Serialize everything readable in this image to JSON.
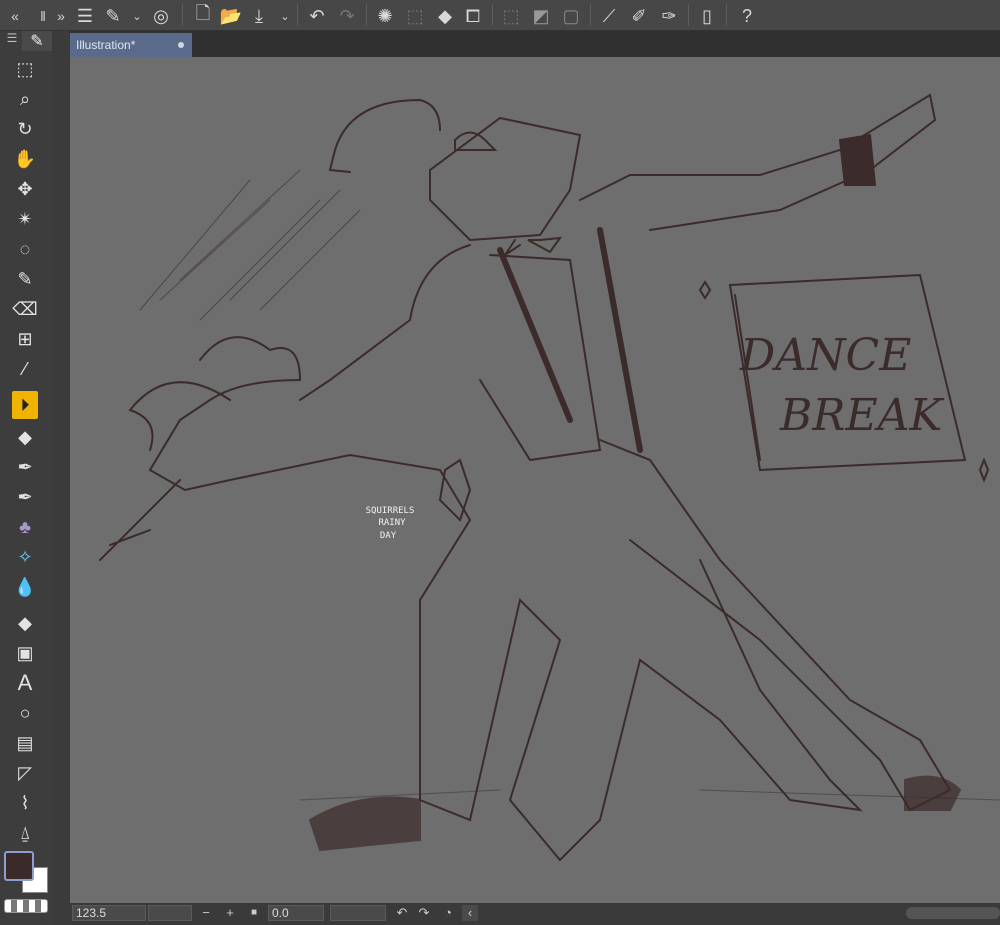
{
  "app": {
    "document_tab": "Illustration*"
  },
  "toolbar": {
    "icons": [
      "collapse-left",
      "panel-grip",
      "collapse-right",
      "menu",
      "edit-pen",
      "dropdown",
      "clip-studio",
      "new",
      "open",
      "export",
      "dropdown",
      "undo",
      "redo",
      "select-all",
      "deselect",
      "fill",
      "transform",
      "clear-outside",
      "fill-selection",
      "expand",
      "ruler-snap",
      "pen-pressure",
      "brush-size",
      "smartphone",
      "help"
    ]
  },
  "tools": [
    "selection",
    "zoom",
    "rotate",
    "hand",
    "move",
    "auto-select",
    "lasso",
    "pen",
    "eraser",
    "figure",
    "eyedropper",
    "subtool-active",
    "eraser-2",
    "pen-2",
    "marker",
    "decoration",
    "blend",
    "fill-bucket",
    "gradient",
    "text",
    "figure-circle",
    "frame",
    "ruler",
    "speech-balloon",
    "correct-line"
  ],
  "colors": {
    "main": "#3a2a2a",
    "sub": "#ffffff",
    "canvas": "#6e6e6e",
    "line": "#3b2b2a"
  },
  "status": {
    "zoom": "123.5",
    "angle": "0.0",
    "minus": "−",
    "plus": "+"
  },
  "artwork": {
    "sign_line1": "DANCE",
    "sign_line2": "BREAK",
    "watermark": [
      "SQUIRRELS",
      "RAINY",
      "DAY"
    ]
  }
}
